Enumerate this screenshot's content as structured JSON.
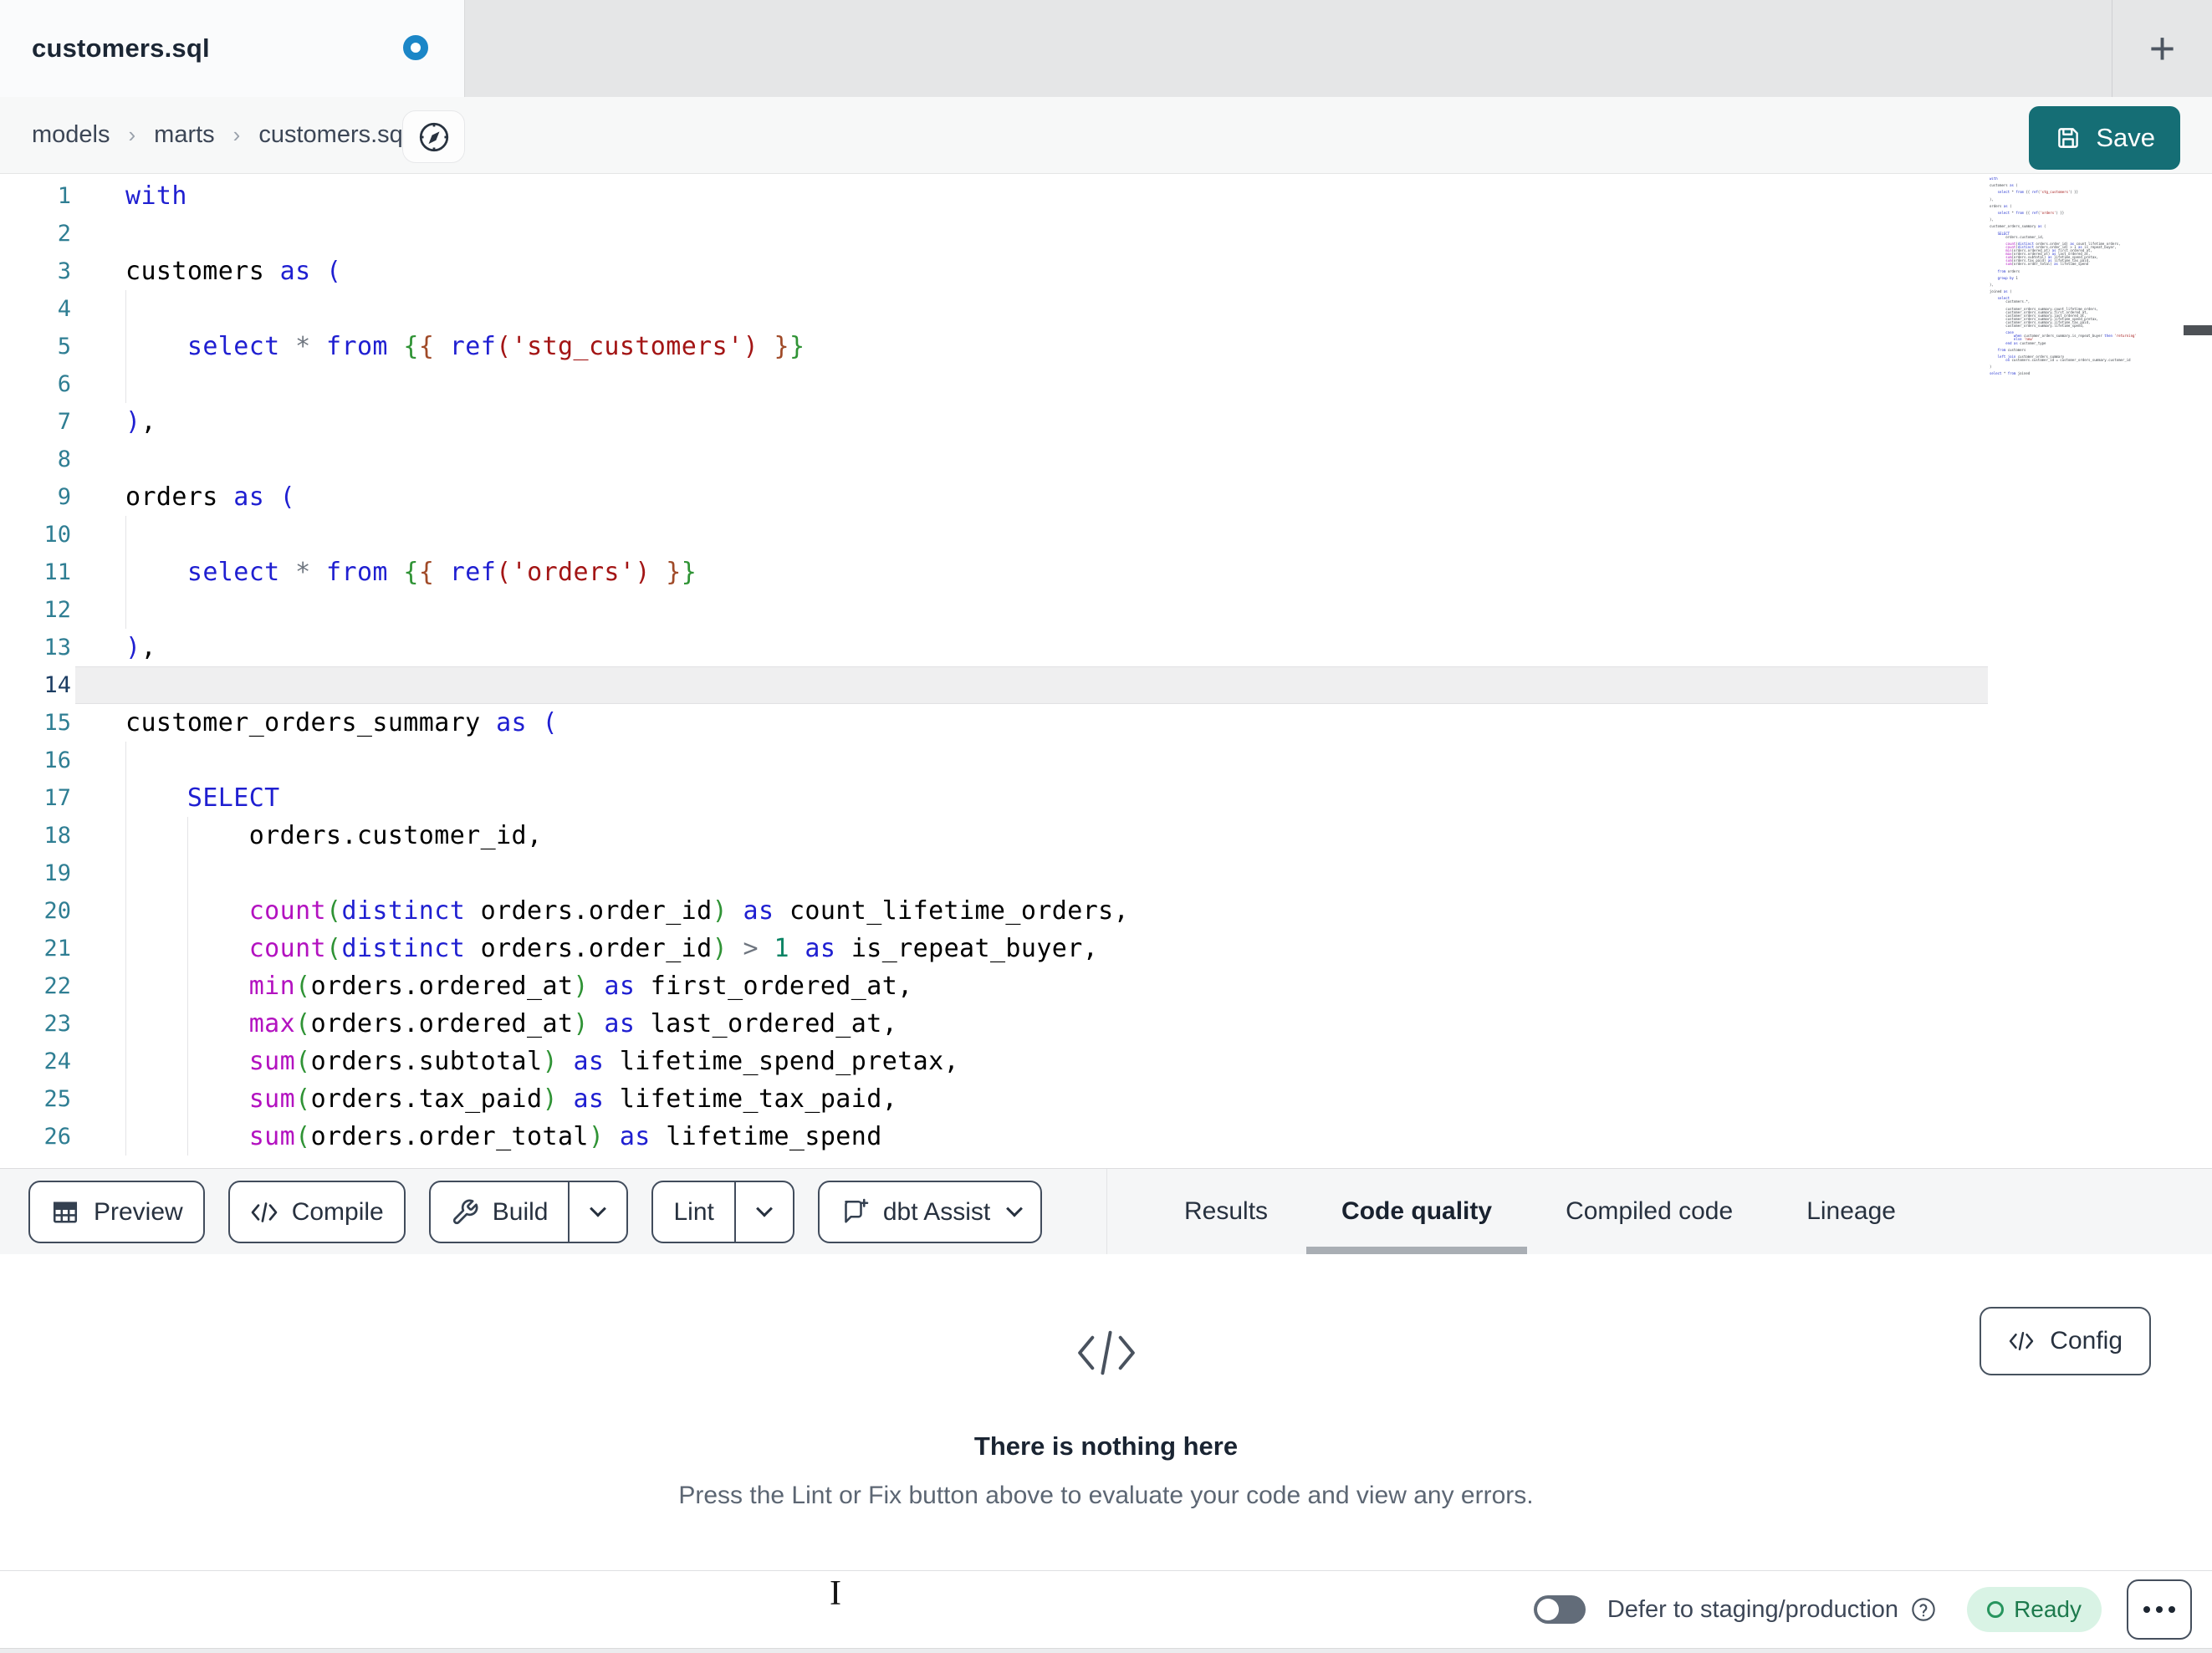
{
  "colors": {
    "accent_teal": "#156e75",
    "dirty_dot_blue": "#1b86c7",
    "ready_green_bg": "#d9f3e5",
    "ready_green_text": "#1d7a4d",
    "keyword_blue": "#1f1fd1",
    "function_magenta": "#b312c0",
    "string_red": "#a31515",
    "bracket_green": "#2f9335",
    "line_number_teal": "#2f7e93"
  },
  "window": {
    "active_tab": "customers.sql",
    "new_tab": "+"
  },
  "breadcrumb": {
    "items": [
      "models",
      "marts",
      "customers.sql"
    ]
  },
  "save_button": {
    "label": "Save"
  },
  "editor": {
    "active_line": 14,
    "lines": [
      {
        "n": 1,
        "g": [],
        "t": [
          [
            "with",
            "kw"
          ]
        ]
      },
      {
        "n": 2,
        "g": [],
        "t": []
      },
      {
        "n": 3,
        "g": [],
        "t": [
          [
            "customers",
            "id"
          ],
          [
            " ",
            "id"
          ],
          [
            "as",
            "kw"
          ],
          [
            " ",
            "id"
          ],
          [
            "(",
            "pb"
          ]
        ]
      },
      {
        "n": 4,
        "g": [
          0
        ],
        "t": []
      },
      {
        "n": 5,
        "g": [
          0
        ],
        "t": [
          [
            "    ",
            "id"
          ],
          [
            "select",
            "kw"
          ],
          [
            " ",
            "id"
          ],
          [
            "*",
            "op"
          ],
          [
            " ",
            "id"
          ],
          [
            "from",
            "kw"
          ],
          [
            " ",
            "id"
          ],
          [
            "{",
            "bg"
          ],
          [
            "{",
            "bo"
          ],
          [
            " ",
            "id"
          ],
          [
            "ref",
            "kw"
          ],
          [
            "(",
            "st"
          ],
          [
            "'stg_customers'",
            "st"
          ],
          [
            ")",
            "st"
          ],
          [
            " ",
            "id"
          ],
          [
            "}",
            "bo"
          ],
          [
            "}",
            "bg"
          ]
        ]
      },
      {
        "n": 6,
        "g": [
          0
        ],
        "t": []
      },
      {
        "n": 7,
        "g": [],
        "t": [
          [
            ")",
            "pb"
          ],
          [
            ",",
            "id"
          ]
        ]
      },
      {
        "n": 8,
        "g": [],
        "t": []
      },
      {
        "n": 9,
        "g": [],
        "t": [
          [
            "orders",
            "id"
          ],
          [
            " ",
            "id"
          ],
          [
            "as",
            "kw"
          ],
          [
            " ",
            "id"
          ],
          [
            "(",
            "pb"
          ]
        ]
      },
      {
        "n": 10,
        "g": [
          0
        ],
        "t": []
      },
      {
        "n": 11,
        "g": [
          0
        ],
        "t": [
          [
            "    ",
            "id"
          ],
          [
            "select",
            "kw"
          ],
          [
            " ",
            "id"
          ],
          [
            "*",
            "op"
          ],
          [
            " ",
            "id"
          ],
          [
            "from",
            "kw"
          ],
          [
            " ",
            "id"
          ],
          [
            "{",
            "bg"
          ],
          [
            "{",
            "bo"
          ],
          [
            " ",
            "id"
          ],
          [
            "ref",
            "kw"
          ],
          [
            "(",
            "st"
          ],
          [
            "'orders'",
            "st"
          ],
          [
            ")",
            "st"
          ],
          [
            " ",
            "id"
          ],
          [
            "}",
            "bo"
          ],
          [
            "}",
            "bg"
          ]
        ]
      },
      {
        "n": 12,
        "g": [
          0
        ],
        "t": []
      },
      {
        "n": 13,
        "g": [],
        "t": [
          [
            ")",
            "pb"
          ],
          [
            ",",
            "id"
          ]
        ]
      },
      {
        "n": 14,
        "g": [],
        "t": []
      },
      {
        "n": 15,
        "g": [],
        "t": [
          [
            "customer_orders_summary",
            "id"
          ],
          [
            " ",
            "id"
          ],
          [
            "as",
            "kw"
          ],
          [
            " ",
            "id"
          ],
          [
            "(",
            "pb"
          ]
        ]
      },
      {
        "n": 16,
        "g": [
          0
        ],
        "t": []
      },
      {
        "n": 17,
        "g": [
          0
        ],
        "t": [
          [
            "    ",
            "id"
          ],
          [
            "SELECT",
            "kw"
          ]
        ]
      },
      {
        "n": 18,
        "g": [
          0,
          1
        ],
        "t": [
          [
            "        ",
            "id"
          ],
          [
            "orders.customer_id,",
            "id"
          ]
        ]
      },
      {
        "n": 19,
        "g": [
          0,
          1
        ],
        "t": []
      },
      {
        "n": 20,
        "g": [
          0,
          1
        ],
        "t": [
          [
            "        ",
            "id"
          ],
          [
            "count",
            "fn"
          ],
          [
            "(",
            "bg"
          ],
          [
            "distinct",
            "kw"
          ],
          [
            " ",
            "id"
          ],
          [
            "orders.order_id",
            "id"
          ],
          [
            ")",
            "bg"
          ],
          [
            " ",
            "id"
          ],
          [
            "as",
            "kw"
          ],
          [
            " ",
            "id"
          ],
          [
            "count_lifetime_orders,",
            "id"
          ]
        ]
      },
      {
        "n": 21,
        "g": [
          0,
          1
        ],
        "t": [
          [
            "        ",
            "id"
          ],
          [
            "count",
            "fn"
          ],
          [
            "(",
            "bg"
          ],
          [
            "distinct",
            "kw"
          ],
          [
            " ",
            "id"
          ],
          [
            "orders.order_id",
            "id"
          ],
          [
            ")",
            "bg"
          ],
          [
            " ",
            "id"
          ],
          [
            ">",
            "op"
          ],
          [
            " ",
            "id"
          ],
          [
            "1",
            "nu"
          ],
          [
            " ",
            "id"
          ],
          [
            "as",
            "kw"
          ],
          [
            " ",
            "id"
          ],
          [
            "is_repeat_buyer,",
            "id"
          ]
        ]
      },
      {
        "n": 22,
        "g": [
          0,
          1
        ],
        "t": [
          [
            "        ",
            "id"
          ],
          [
            "min",
            "fn"
          ],
          [
            "(",
            "bg"
          ],
          [
            "orders.ordered_at",
            "id"
          ],
          [
            ")",
            "bg"
          ],
          [
            " ",
            "id"
          ],
          [
            "as",
            "kw"
          ],
          [
            " ",
            "id"
          ],
          [
            "first_ordered_at,",
            "id"
          ]
        ]
      },
      {
        "n": 23,
        "g": [
          0,
          1
        ],
        "t": [
          [
            "        ",
            "id"
          ],
          [
            "max",
            "fn"
          ],
          [
            "(",
            "bg"
          ],
          [
            "orders.ordered_at",
            "id"
          ],
          [
            ")",
            "bg"
          ],
          [
            " ",
            "id"
          ],
          [
            "as",
            "kw"
          ],
          [
            " ",
            "id"
          ],
          [
            "last_ordered_at,",
            "id"
          ]
        ]
      },
      {
        "n": 24,
        "g": [
          0,
          1
        ],
        "t": [
          [
            "        ",
            "id"
          ],
          [
            "sum",
            "fn"
          ],
          [
            "(",
            "bg"
          ],
          [
            "orders.subtotal",
            "id"
          ],
          [
            ")",
            "bg"
          ],
          [
            " ",
            "id"
          ],
          [
            "as",
            "kw"
          ],
          [
            " ",
            "id"
          ],
          [
            "lifetime_spend_pretax,",
            "id"
          ]
        ]
      },
      {
        "n": 25,
        "g": [
          0,
          1
        ],
        "t": [
          [
            "        ",
            "id"
          ],
          [
            "sum",
            "fn"
          ],
          [
            "(",
            "bg"
          ],
          [
            "orders.tax_paid",
            "id"
          ],
          [
            ")",
            "bg"
          ],
          [
            " ",
            "id"
          ],
          [
            "as",
            "kw"
          ],
          [
            " ",
            "id"
          ],
          [
            "lifetime_tax_paid,",
            "id"
          ]
        ]
      },
      {
        "n": 26,
        "g": [
          0,
          1
        ],
        "t": [
          [
            "        ",
            "id"
          ],
          [
            "sum",
            "fn"
          ],
          [
            "(",
            "bg"
          ],
          [
            "orders.order_total",
            "id"
          ],
          [
            ")",
            "bg"
          ],
          [
            " ",
            "id"
          ],
          [
            "as",
            "kw"
          ],
          [
            " ",
            "id"
          ],
          [
            "lifetime_spend",
            "id"
          ]
        ]
      }
    ]
  },
  "minimap": {
    "lines": [
      "with",
      "",
      "customers as (",
      "",
      "    select * from {{ ref('stg_customers') }}",
      "",
      "),",
      "",
      "orders as (",
      "",
      "    select * from {{ ref('orders') }}",
      "",
      "),",
      "",
      "customer_orders_summary as (",
      "",
      "    SELECT",
      "        orders.customer_id,",
      "",
      "        count(distinct orders.order_id) as count_lifetime_orders,",
      "        count(distinct orders.order_id) > 1 as is_repeat_buyer,",
      "        min(orders.ordered_at) as first_ordered_at,",
      "        max(orders.ordered_at) as last_ordered_at,",
      "        sum(orders.subtotal) as lifetime_spend_pretax,",
      "        sum(orders.tax_paid) as lifetime_tax_paid,",
      "        sum(orders.order_total) as lifetime_spend",
      "",
      "    from orders",
      "",
      "    group by 1",
      "",
      "),",
      "",
      "joined as (",
      "",
      "    select",
      "        customers.*,",
      "",
      "        customer_orders_summary.count_lifetime_orders,",
      "        customer_orders_summary.first_ordered_at,",
      "        customer_orders_summary.last_ordered_at,",
      "        customer_orders_summary.lifetime_spend_pretax,",
      "        customer_orders_summary.lifetime_tax_paid,",
      "        customer_orders_summary.lifetime_spend,",
      "",
      "        case",
      "            when customer_orders_summary.is_repeat_buyer then 'returning'",
      "            else 'new'",
      "        end as customer_type",
      "",
      "    from customers",
      "",
      "    left join customer_orders_summary",
      "        on customers.customer_id = customer_orders_summary.customer_id",
      "",
      ")",
      "",
      "select * from joined"
    ]
  },
  "toolbar": {
    "buttons": [
      {
        "label": "Preview",
        "icon": "table-icon"
      },
      {
        "label": "Compile",
        "icon": "code-icon"
      },
      {
        "label": "Build",
        "icon": "wrench-icon",
        "split": true
      },
      {
        "label": "Lint",
        "split": true
      },
      {
        "label": "dbt Assist",
        "icon": "assist-icon",
        "chevron": true
      }
    ]
  },
  "panel_tabs": {
    "tabs": [
      {
        "label": "Results",
        "active": false
      },
      {
        "label": "Code quality",
        "active": true
      },
      {
        "label": "Compiled code",
        "active": false
      },
      {
        "label": "Lineage",
        "active": false
      }
    ]
  },
  "empty_state": {
    "title": "There is nothing here",
    "subtitle": "Press the Lint or Fix button above to evaluate your code and view any errors.",
    "config_label": "Config"
  },
  "status_bar": {
    "defer_label": "Defer to staging/production",
    "ready_label": "Ready"
  }
}
